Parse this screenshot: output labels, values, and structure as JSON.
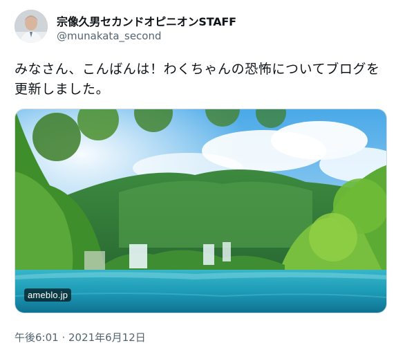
{
  "author": {
    "display_name": "宗像久男セカンドオピニオンSTAFF",
    "handle": "@munakata_second"
  },
  "tweet": {
    "text": "みなさん、こんばんは！わくちゃんの恐怖についてブログを更新しました。"
  },
  "link_card": {
    "domain": "ameblo.jp"
  },
  "meta": {
    "time": "午後6:01",
    "separator": " · ",
    "date": "2021年6月12日"
  },
  "colors": {
    "text_primary": "#0f1419",
    "text_secondary": "#536471",
    "border": "#cfd9de"
  }
}
